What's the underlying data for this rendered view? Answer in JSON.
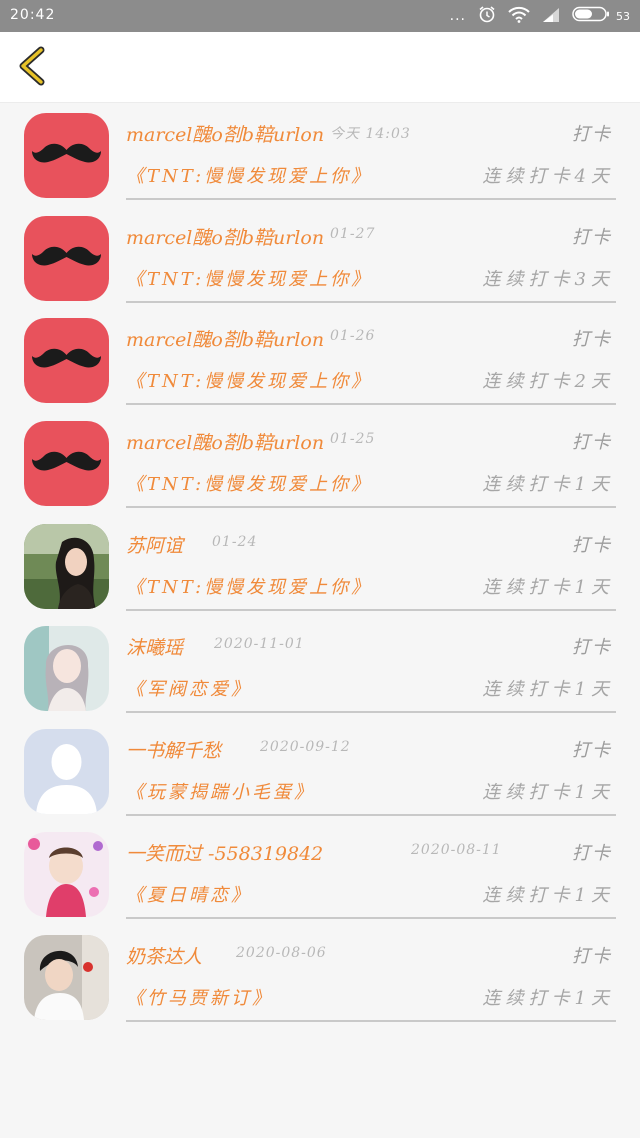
{
  "status_bar": {
    "time": "20:42",
    "dots": "...",
    "battery_text": "53",
    "icons": [
      "alarm-icon",
      "wifi-icon",
      "signal-icon",
      "battery-icon"
    ]
  },
  "header": {
    "back_icon": "back-chevron-icon"
  },
  "colors": {
    "accent": "#f08a3a",
    "back_chevron": "#e7c228",
    "mustache_bg": "#e8525c"
  },
  "records": [
    {
      "name": "marcel醜o剳b鞛urlon",
      "time": "今天 14:03",
      "checkin": "打卡",
      "book": "《TNT:慢慢发现爱上你》",
      "streak": "连续打卡4天",
      "avatar": "mustache"
    },
    {
      "name": "marcel醜o剳b鞛urlon",
      "time": "01-27",
      "checkin": "打卡",
      "book": "《TNT:慢慢发现爱上你》",
      "streak": "连续打卡3天",
      "avatar": "mustache"
    },
    {
      "name": "marcel醜o剳b鞛urlon",
      "time": "01-26",
      "checkin": "打卡",
      "book": "《TNT:慢慢发现爱上你》",
      "streak": "连续打卡2天",
      "avatar": "mustache"
    },
    {
      "name": "marcel醜o剳b鞛urlon",
      "time": "01-25",
      "checkin": "打卡",
      "book": "《TNT:慢慢发现爱上你》",
      "streak": "连续打卡1天",
      "avatar": "mustache"
    },
    {
      "name": "苏阿谊",
      "time": "01-24",
      "checkin": "打卡",
      "book": "《TNT:慢慢发现爱上你》",
      "streak": "连续打卡1天",
      "avatar": "photo-girl-dark"
    },
    {
      "name": "沫曦瑶",
      "time": "2020-11-01",
      "checkin": "打卡",
      "book": "《军阀恋爱》",
      "streak": "连续打卡1天",
      "avatar": "photo-girl-light"
    },
    {
      "name": "一书解千愁",
      "time": "2020-09-12",
      "checkin": "打卡",
      "book": "《玩蒙揭踹小毛蛋》",
      "streak": "连续打卡1天",
      "avatar": "default-user"
    },
    {
      "name": "一笑而过  -558319842",
      "time": "2020-08-11",
      "checkin": "打卡",
      "book": "《夏日晴恋》",
      "streak": "连续打卡1天",
      "avatar": "photo-baby"
    },
    {
      "name": "奶茶达人",
      "time": "2020-08-06",
      "checkin": "打卡",
      "book": "《竹马贾新订》",
      "streak": "连续打卡1天",
      "avatar": "photo-boy"
    }
  ]
}
